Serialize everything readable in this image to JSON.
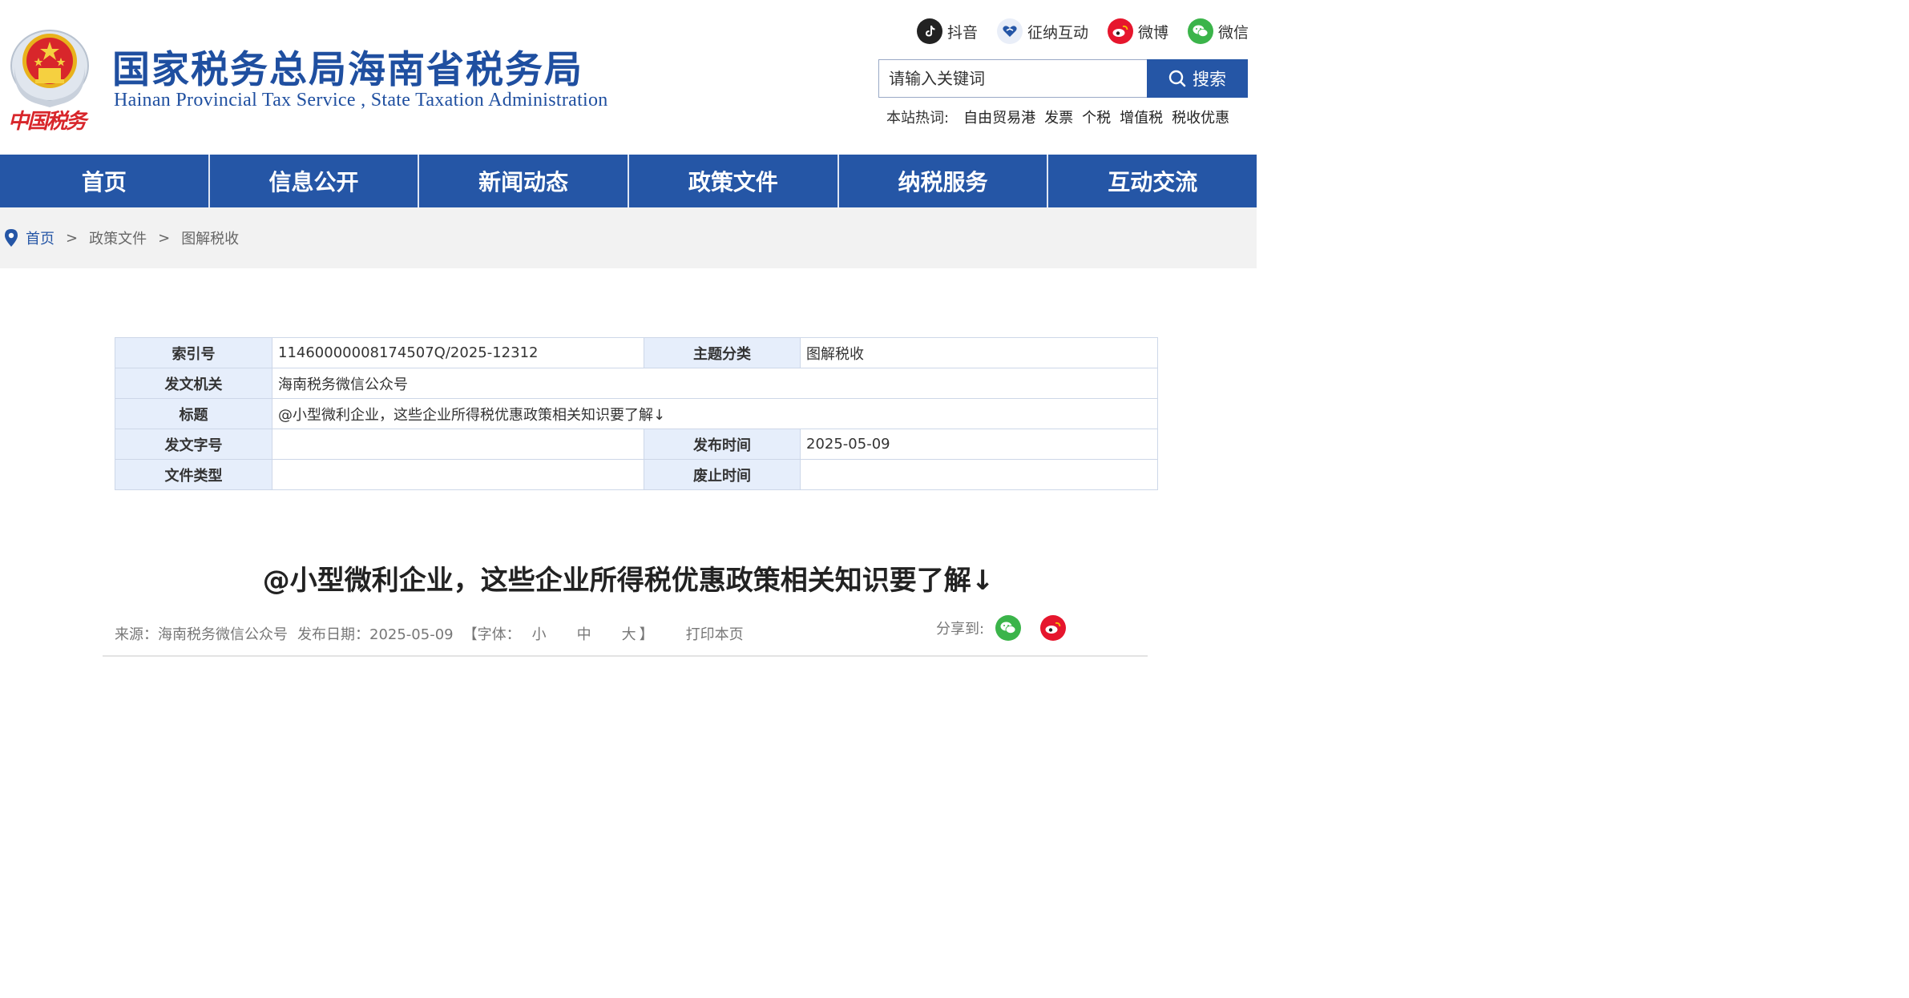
{
  "colors": {
    "brand_blue": "#2556a6",
    "title_blue": "#1f4fa0",
    "emblem_red": "#d8262b",
    "emblem_gold": "#e8b21c",
    "wechat_green": "#3bb44a",
    "weibo_red": "#e6162d"
  },
  "header": {
    "title": "国家税务总局海南省税务局",
    "subtitle": "Hainan  Provincial  Tax  Service ,  State  Taxation  Administration",
    "logo_text": "中国税务",
    "social": [
      {
        "label": "抖音",
        "icon": "douyin-icon"
      },
      {
        "label": "征纳互动",
        "icon": "interaction-icon"
      },
      {
        "label": "微博",
        "icon": "weibo-icon"
      },
      {
        "label": "微信",
        "icon": "wechat-icon"
      }
    ],
    "search": {
      "placeholder": "请输入关键词",
      "button_label": "搜索"
    },
    "hot": {
      "label": "本站热词:",
      "items": [
        "自由贸易港",
        "发票",
        "个税",
        "增值税",
        "税收优惠"
      ]
    }
  },
  "nav": {
    "items": [
      "首页",
      "信息公开",
      "新闻动态",
      "政策文件",
      "纳税服务",
      "互动交流"
    ]
  },
  "breadcrumb": {
    "home": "首页",
    "sep": ">",
    "items": [
      "政策文件",
      "图解税收"
    ]
  },
  "meta": {
    "index_no_label": "索引号",
    "index_no": "11460000008174507Q/2025-12312",
    "topic_label": "主题分类",
    "topic": "图解税收",
    "issuer_label": "发文机关",
    "issuer": "海南税务微信公众号",
    "title_label": "标题",
    "title": "@小型微利企业，这些企业所得税优惠政策相关知识要了解↓",
    "doc_no_label": "发文字号",
    "doc_no": "",
    "publish_label": "发布时间",
    "publish": "2025-05-09",
    "type_label": "文件类型",
    "type": "",
    "expire_label": "废止时间",
    "expire": ""
  },
  "article": {
    "title": "@小型微利企业，这些企业所得税优惠政策相关知识要了解↓",
    "source": "来源：海南税务微信公众号",
    "date": "发布日期：2025-05-09",
    "font_open": "【字体：",
    "font_small": "小",
    "font_medium": "中",
    "font_large": "大",
    "font_close": "】",
    "print": "打印本页",
    "share_label": "分享到:"
  }
}
